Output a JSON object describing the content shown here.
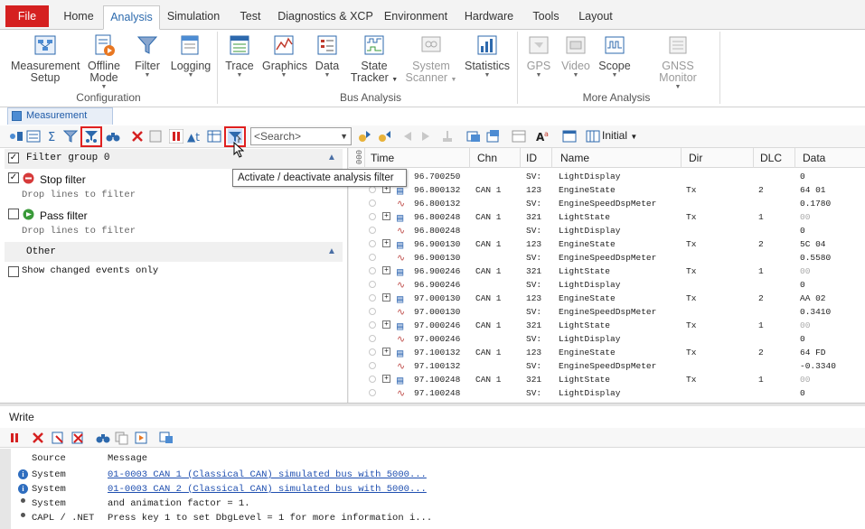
{
  "tabs": [
    "File",
    "Home",
    "Analysis",
    "Simulation",
    "Test",
    "Diagnostics & XCP",
    "Environment",
    "Hardware",
    "Tools",
    "Layout"
  ],
  "active_tab": "Analysis",
  "ribbon": {
    "configuration": {
      "group_label": "Configuration",
      "buttons": [
        {
          "line1": "Measurement",
          "line2": "Setup",
          "icon": "measurement-setup-icon"
        },
        {
          "line1": "Offline",
          "line2": "Mode",
          "icon": "offline-mode-icon",
          "dropdown": true
        },
        {
          "line1": "Filter",
          "line2": "",
          "icon": "filter-icon",
          "dropdown": true
        },
        {
          "line1": "Logging",
          "line2": "",
          "icon": "logging-icon",
          "dropdown": true
        }
      ]
    },
    "bus_analysis": {
      "group_label": "Bus Analysis",
      "buttons": [
        {
          "line1": "Trace",
          "icon": "trace-icon"
        },
        {
          "line1": "Graphics",
          "icon": "graphics-icon"
        },
        {
          "line1": "Data",
          "icon": "data-icon"
        },
        {
          "line1": "State",
          "line2": "Tracker",
          "icon": "state-tracker-icon"
        },
        {
          "line1": "System",
          "line2": "Scanner",
          "icon": "system-scanner-icon",
          "disabled": true
        },
        {
          "line1": "Statistics",
          "icon": "statistics-icon"
        }
      ]
    },
    "more_analysis": {
      "group_label": "More Analysis",
      "buttons": [
        {
          "line1": "GPS",
          "icon": "gps-icon",
          "disabled": true
        },
        {
          "line1": "Video",
          "icon": "video-icon",
          "disabled": true
        },
        {
          "line1": "Scope",
          "icon": "scope-icon"
        },
        {
          "line1": "GNSS Monitor",
          "icon": "gnss-monitor-icon",
          "disabled": true
        }
      ]
    }
  },
  "measurement_setup_tab": "Measurement Setup",
  "toolbar": {
    "search_placeholder": "<Search>",
    "initial_label": "Initial",
    "tooltip": "Activate / deactivate analysis filter"
  },
  "filter_pane": {
    "group_title": "Filter group 0",
    "stop_filter": "Stop filter",
    "pass_filter": "Pass filter",
    "drop_hint": "Drop lines to filter",
    "other_title": "Other",
    "show_changed": "Show changed events only"
  },
  "trace": {
    "columns": [
      "Time",
      "Chn",
      "ID",
      "Name",
      "Dir",
      "DLC",
      "Data"
    ],
    "rows": [
      {
        "kind": "sv",
        "time": "96.700250",
        "chn": "",
        "id": "SV:",
        "name": "LightDisplay",
        "dir": "",
        "dlc": "",
        "data": "0"
      },
      {
        "kind": "msg",
        "time": "96.800132",
        "chn": "CAN 1",
        "id": "123",
        "name": "EngineState",
        "dir": "Tx",
        "dlc": "2",
        "data": "64 01"
      },
      {
        "kind": "sv",
        "time": "96.800132",
        "chn": "",
        "id": "SV:",
        "name": "EngineSpeedDspMeter",
        "dir": "",
        "dlc": "",
        "data": "0.1780"
      },
      {
        "kind": "msg",
        "time": "96.800248",
        "chn": "CAN 1",
        "id": "321",
        "name": "LightState",
        "dir": "Tx",
        "dlc": "1",
        "data": "00"
      },
      {
        "kind": "sv",
        "time": "96.800248",
        "chn": "",
        "id": "SV:",
        "name": "LightDisplay",
        "dir": "",
        "dlc": "",
        "data": "0"
      },
      {
        "kind": "msg",
        "time": "96.900130",
        "chn": "CAN 1",
        "id": "123",
        "name": "EngineState",
        "dir": "Tx",
        "dlc": "2",
        "data": "5C 04"
      },
      {
        "kind": "sv",
        "time": "96.900130",
        "chn": "",
        "id": "SV:",
        "name": "EngineSpeedDspMeter",
        "dir": "",
        "dlc": "",
        "data": "0.5580"
      },
      {
        "kind": "msg",
        "time": "96.900246",
        "chn": "CAN 1",
        "id": "321",
        "name": "LightState",
        "dir": "Tx",
        "dlc": "1",
        "data": "00"
      },
      {
        "kind": "sv",
        "time": "96.900246",
        "chn": "",
        "id": "SV:",
        "name": "LightDisplay",
        "dir": "",
        "dlc": "",
        "data": "0"
      },
      {
        "kind": "msg",
        "time": "97.000130",
        "chn": "CAN 1",
        "id": "123",
        "name": "EngineState",
        "dir": "Tx",
        "dlc": "2",
        "data": "AA 02"
      },
      {
        "kind": "sv",
        "time": "97.000130",
        "chn": "",
        "id": "SV:",
        "name": "EngineSpeedDspMeter",
        "dir": "",
        "dlc": "",
        "data": "0.3410"
      },
      {
        "kind": "msg",
        "time": "97.000246",
        "chn": "CAN 1",
        "id": "321",
        "name": "LightState",
        "dir": "Tx",
        "dlc": "1",
        "data": "00"
      },
      {
        "kind": "sv",
        "time": "97.000246",
        "chn": "",
        "id": "SV:",
        "name": "LightDisplay",
        "dir": "",
        "dlc": "",
        "data": "0"
      },
      {
        "kind": "msg",
        "time": "97.100132",
        "chn": "CAN 1",
        "id": "123",
        "name": "EngineState",
        "dir": "Tx",
        "dlc": "2",
        "data": "64 FD"
      },
      {
        "kind": "sv",
        "time": "97.100132",
        "chn": "",
        "id": "SV:",
        "name": "EngineSpeedDspMeter",
        "dir": "",
        "dlc": "",
        "data": "-0.3340"
      },
      {
        "kind": "msg",
        "time": "97.100248",
        "chn": "CAN 1",
        "id": "321",
        "name": "LightState",
        "dir": "Tx",
        "dlc": "1",
        "data": "00"
      },
      {
        "kind": "sv",
        "time": "97.100248",
        "chn": "",
        "id": "SV:",
        "name": "LightDisplay",
        "dir": "",
        "dlc": "",
        "data": "0"
      }
    ]
  },
  "write": {
    "title": "Write",
    "columns": [
      "Source",
      "Message"
    ],
    "rows": [
      {
        "icon": "info",
        "source": "System",
        "message": "01-0003 CAN 1 (Classical CAN)  simulated bus with 5000...",
        "link": true
      },
      {
        "icon": "info",
        "source": "System",
        "message": "01-0003 CAN 2 (Classical CAN)  simulated bus with 5000...",
        "link": true
      },
      {
        "icon": "dot",
        "source": "System",
        "message": "  and animation factor = 1.",
        "link": false
      },
      {
        "icon": "dot",
        "source": "CAPL / .NET",
        "message": "Press key 1 to set DbgLevel = 1 for more information i...",
        "link": false
      }
    ]
  },
  "colors": {
    "file_tab": "#d52020",
    "accent": "#2c6aad",
    "highlight": "#e02020",
    "link": "#1f4fb0"
  }
}
